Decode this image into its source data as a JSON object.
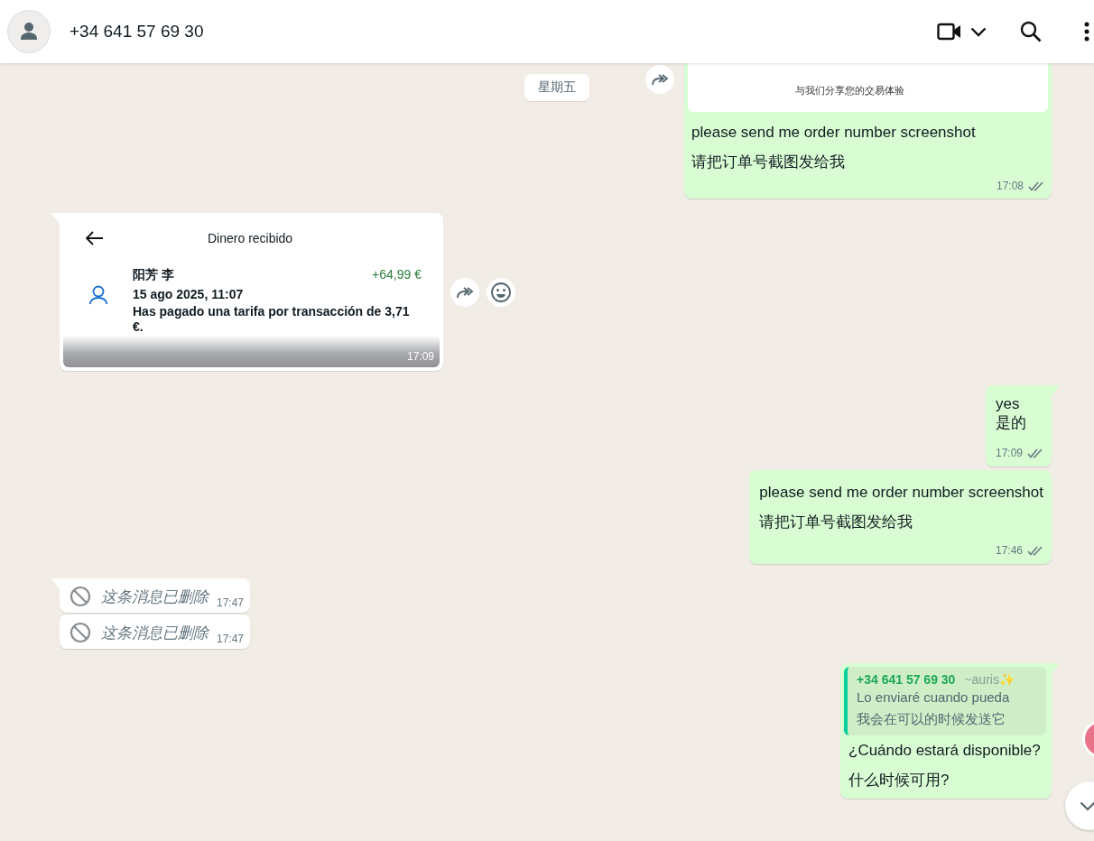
{
  "header": {
    "contact": "+34 641 57 69 30"
  },
  "date_chip": "星期五",
  "messages": [
    {
      "kind": "image_text",
      "outgoing": true,
      "tail": false,
      "image_caption": "与我们分享您的交易体验",
      "lines": [
        "please send me order number screenshot",
        "请把订单号截图发给我"
      ],
      "time": "17:08",
      "double_tick": true,
      "forward": true
    },
    {
      "kind": "payment_screenshot",
      "outgoing": false,
      "tail": true,
      "screen_title": "Dinero recibido",
      "payer": "阳芳 李",
      "amount": "+64,99 €",
      "date": "15 ago 2025, 11:07",
      "note": "Has pagado una tarifa por transacción de 3,71 €.",
      "time": "17:09",
      "forward": true,
      "react": true
    },
    {
      "kind": "text",
      "outgoing": true,
      "tail": true,
      "lines": [
        "yes",
        "是的"
      ],
      "time": "17:09",
      "double_tick": true
    },
    {
      "kind": "text",
      "outgoing": true,
      "tail": false,
      "lines": [
        "please send me order number screenshot",
        "请把订单号截图发给我"
      ],
      "time": "17:46",
      "double_tick": true
    },
    {
      "kind": "deleted",
      "outgoing": false,
      "tail": true,
      "text": "这条消息已删除",
      "time": "17:47"
    },
    {
      "kind": "deleted",
      "outgoing": false,
      "tail": false,
      "text": "这条消息已删除",
      "time": "17:47"
    },
    {
      "kind": "reply",
      "outgoing": true,
      "tail": true,
      "quote": {
        "author": "+34 641 57 69 30",
        "alias": "~auris✨",
        "lines": [
          "Lo enviaré cuando pueda",
          "我会在可以的时候发送它"
        ]
      },
      "lines": [
        "¿Cuándo estará disponible?",
        "什么时候可用?"
      ]
    }
  ]
}
